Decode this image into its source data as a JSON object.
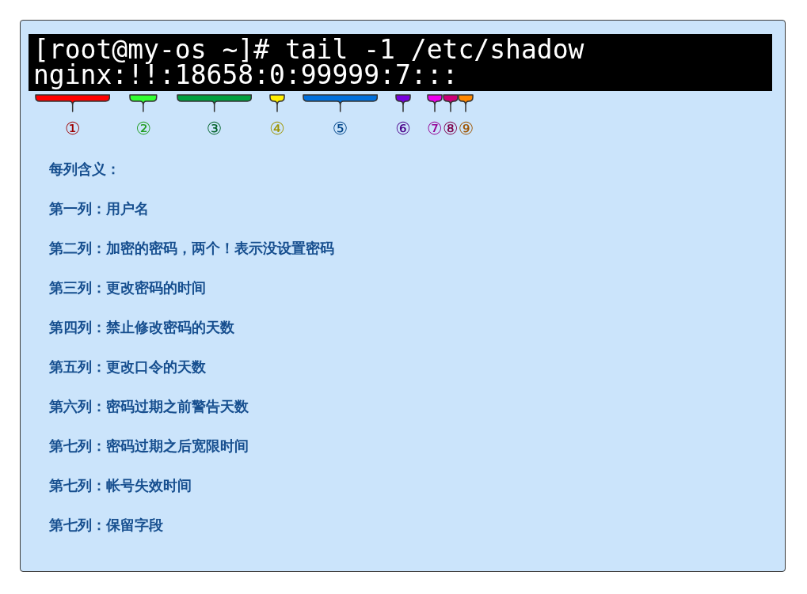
{
  "terminal": {
    "command_line": "[root@my-os ~]# tail -1 /etc/shadow",
    "output_line": "nginx:!!:18658:0:99999:7:::"
  },
  "markers": [
    {
      "label": "①",
      "color": "#ff0000"
    },
    {
      "label": "②",
      "color": "#33ff33"
    },
    {
      "label": "③",
      "color": "#00a040"
    },
    {
      "label": "④",
      "color": "#ffee00"
    },
    {
      "label": "⑤",
      "color": "#0070dd"
    },
    {
      "label": "⑥",
      "color": "#7700dd"
    },
    {
      "label": "⑦",
      "color": "#ee00ee"
    },
    {
      "label": "⑧",
      "color": "#cc0077"
    },
    {
      "label": "⑨",
      "color": "#ff8800"
    }
  ],
  "legend": {
    "heading": "每列含义：",
    "items": [
      "第一列：用户名",
      "第二列：加密的密码，两个！表示没设置密码",
      "第三列：更改密码的时间",
      "第四列：禁止修改密码的天数",
      "第五列：更改口令的天数",
      "第六列：密码过期之前警告天数",
      "第七列：密码过期之后宽限时间",
      "第七列：帐号失效时间",
      "第七列：保留字段"
    ]
  }
}
